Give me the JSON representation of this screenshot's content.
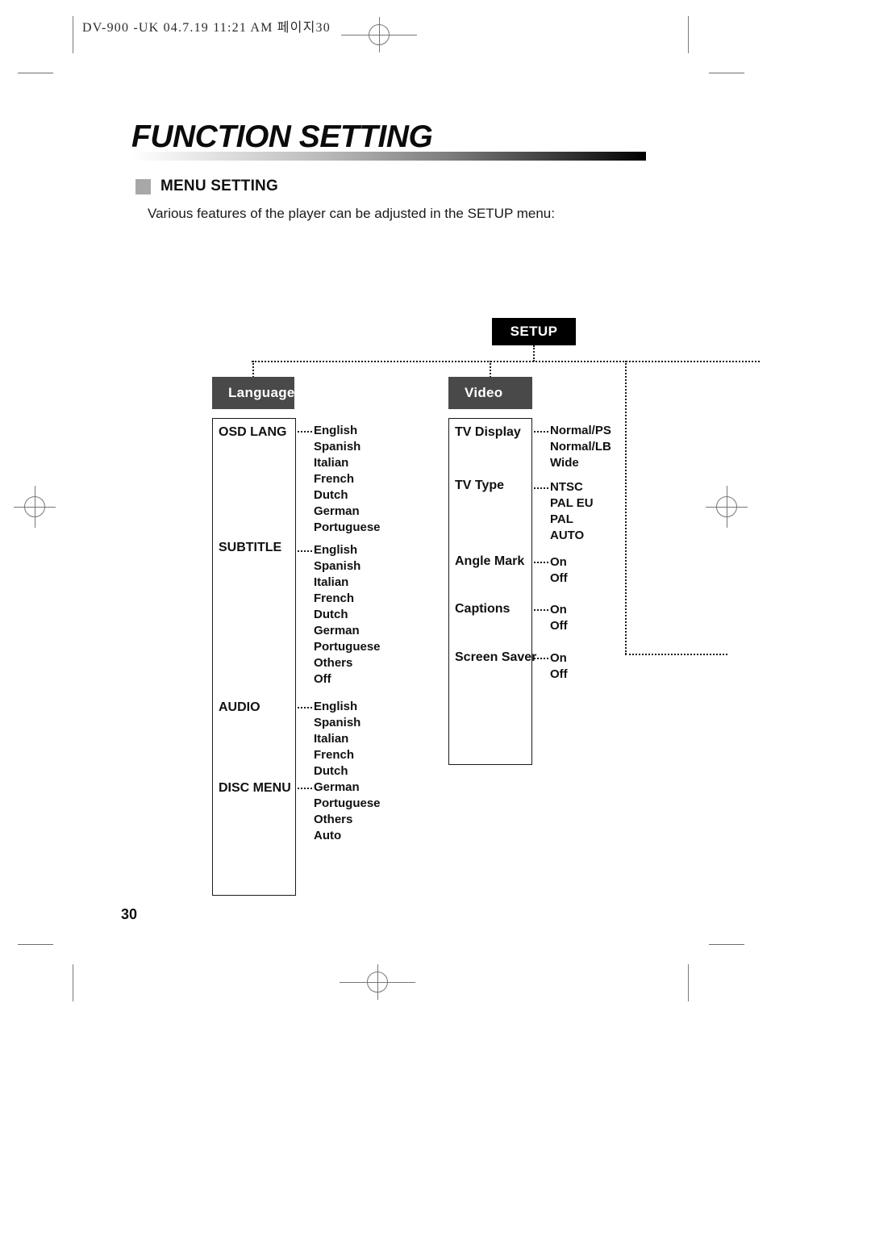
{
  "print": {
    "slug": "DV-900 -UK  04.7.19 11:21 AM  페이지30"
  },
  "page": {
    "title": "FUNCTION SETTING",
    "page_number": "30"
  },
  "section": {
    "heading": "MENU SETTING",
    "intro": "Various features of the player can be adjusted in the SETUP menu:"
  },
  "colors": {
    "root_node_bg": "#000000",
    "category_node_bg": "#494949",
    "bullet_gray": "#a8a8a8",
    "text": "#111111",
    "box_border": "#1a1a1a"
  },
  "diagram": {
    "root": {
      "label": "SETUP"
    },
    "categories": [
      {
        "id": "language",
        "label": "Language",
        "options": [
          {
            "label": "OSD LANG",
            "values": [
              "English",
              "Spanish",
              "Italian",
              "French",
              "Dutch",
              "German",
              "Portuguese"
            ]
          },
          {
            "label": "SUBTITLE",
            "values": [
              "English",
              "Spanish",
              "Italian",
              "French",
              "Dutch",
              "German",
              "Portuguese",
              "Others",
              "Off"
            ]
          },
          {
            "label": "AUDIO",
            "values": [
              "English",
              "Spanish",
              "Italian",
              "French",
              "Dutch",
              "German",
              "Portuguese",
              "Others",
              "Auto"
            ]
          },
          {
            "label": "DISC MENU",
            "values": []
          }
        ]
      },
      {
        "id": "video",
        "label": "Video",
        "options": [
          {
            "label": "TV Display",
            "values": [
              "Normal/PS",
              "Normal/LB",
              "Wide"
            ]
          },
          {
            "label": "TV Type",
            "values": [
              "NTSC",
              "PAL EU",
              "PAL",
              "AUTO"
            ]
          },
          {
            "label": "Angle Mark",
            "values": [
              "On",
              "Off"
            ]
          },
          {
            "label": "Captions",
            "values": [
              "On",
              "Off"
            ]
          },
          {
            "label": "Screen Saver",
            "values": [
              "On",
              "Off"
            ]
          }
        ]
      }
    ]
  }
}
